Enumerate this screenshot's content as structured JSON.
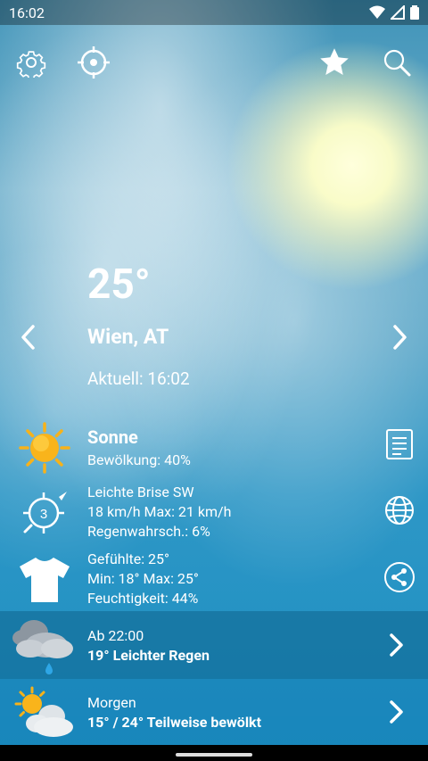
{
  "status_bar": {
    "time": "16:02"
  },
  "current": {
    "temperature": "25°",
    "city": "Wien, AT",
    "updated": "Aktuell: 16:02"
  },
  "condition": {
    "title": "Sonne",
    "cloudiness": "Bewölkung: 40%"
  },
  "wind": {
    "line1": "Leichte Brise SW",
    "line2": "18 km/h Max: 21 km/h",
    "line3": "Regenwahrsch.: 6%",
    "badge": "3"
  },
  "feel": {
    "line1": "Gefühlte: 25°",
    "line2": "Min: 18° Max: 25°",
    "line3": "Feuchtigkeit: 44%"
  },
  "forecast": [
    {
      "label": "Ab 22:00",
      "summary": "19° Leichter Regen"
    },
    {
      "label": "Morgen",
      "summary": "15° / 24° Teilweise bewölkt"
    }
  ],
  "icons": {
    "settings": "gear-icon",
    "location": "crosshair-icon",
    "favorite": "star-icon",
    "search": "search-icon",
    "prev": "chevron-left-icon",
    "next": "chevron-right-icon",
    "sun": "sun-icon",
    "wind": "compass-icon",
    "shirt": "tshirt-icon",
    "details": "document-icon",
    "globe": "globe-icon",
    "share": "share-icon"
  },
  "colors": {
    "sun": "#f7b21a",
    "panel_dark": "#0a5a82",
    "accent_text": "#ffffff"
  }
}
